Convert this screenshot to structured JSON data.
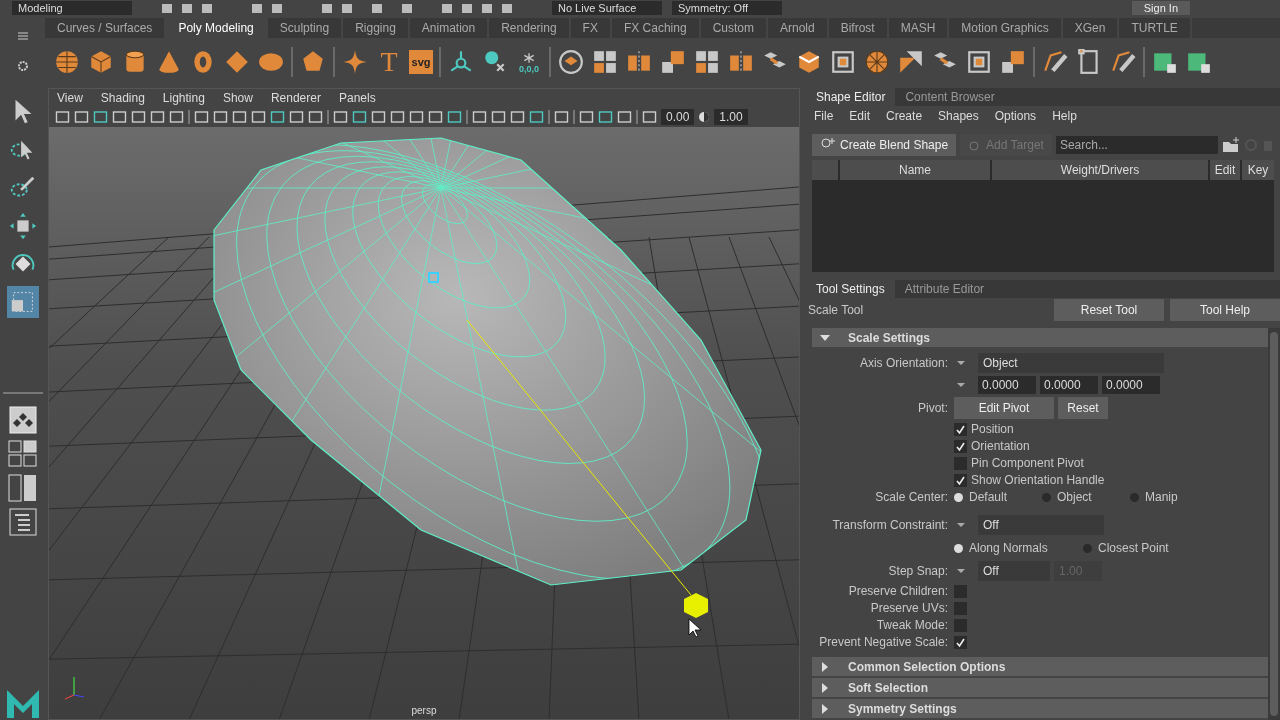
{
  "status_line": {
    "workspace": "Modeling",
    "live_surface": "No Live Surface",
    "symmetry": "Symmetry: Off",
    "sign_in": "Sign In"
  },
  "shelf": {
    "tabs": [
      {
        "label": "Curves / Surfaces",
        "selected": false
      },
      {
        "label": "Poly Modeling",
        "selected": true
      },
      {
        "label": "Sculpting",
        "selected": false
      },
      {
        "label": "Rigging",
        "selected": false
      },
      {
        "label": "Animation",
        "selected": false
      },
      {
        "label": "Rendering",
        "selected": false
      },
      {
        "label": "FX",
        "selected": false
      },
      {
        "label": "FX Caching",
        "selected": false
      },
      {
        "label": "Custom",
        "selected": false
      },
      {
        "label": "Arnold",
        "selected": false
      },
      {
        "label": "Bifrost",
        "selected": false
      },
      {
        "label": "MASH",
        "selected": false
      },
      {
        "label": "Motion Graphics",
        "selected": false
      },
      {
        "label": "XGen",
        "selected": false
      },
      {
        "label": "TURTLE",
        "selected": false
      }
    ],
    "text_tool": "T",
    "svg_tool": "svg",
    "freeze_tool": "0,0,0"
  },
  "toolbox": {
    "tools": [
      {
        "kind": "select",
        "selected": false
      },
      {
        "kind": "lasso",
        "selected": false
      },
      {
        "kind": "paint",
        "selected": false
      },
      {
        "kind": "move",
        "selected": false
      },
      {
        "kind": "rotate",
        "selected": false
      },
      {
        "kind": "scale",
        "selected": true
      }
    ]
  },
  "viewport": {
    "menu": [
      "View",
      "Shading",
      "Lighting",
      "Show",
      "Renderer",
      "Panels"
    ],
    "exposure": "0.00",
    "gamma": "1.00",
    "camera": "persp"
  },
  "shape_editor": {
    "tabs": [
      {
        "label": "Shape Editor",
        "selected": true
      },
      {
        "label": "Content Browser",
        "selected": false
      }
    ],
    "menu": [
      "File",
      "Edit",
      "Create",
      "Shapes",
      "Options",
      "Help"
    ],
    "create_button": "Create Blend Shape",
    "add_target": {
      "label": "Add Target",
      "disabled": true
    },
    "search": {
      "placeholder": "Search..."
    },
    "columns": [
      "Name",
      "Weight/Drivers",
      "Edit",
      "Key"
    ]
  },
  "tool_settings": {
    "tabs": [
      {
        "label": "Tool Settings",
        "selected": true
      },
      {
        "label": "Attribute Editor",
        "selected": false
      }
    ],
    "tool_name": "Scale Tool",
    "buttons": [
      "Reset Tool",
      "Tool Help"
    ],
    "scale_section": {
      "title": "Scale Settings",
      "expanded": true
    },
    "axis_orientation": {
      "label": "Axis Orientation:",
      "value": "Object",
      "values": [
        "0.0000",
        "0.0000",
        "0.0000"
      ]
    },
    "pivot": {
      "label": "Pivot:",
      "buttons": [
        "Edit Pivot",
        "Reset"
      ],
      "options": [
        {
          "label": "Position",
          "checked": true
        },
        {
          "label": "Orientation",
          "checked": true
        },
        {
          "label": "Pin Component Pivot",
          "checked": false
        },
        {
          "label": "Show Orientation Handle",
          "checked": true
        }
      ]
    },
    "scale_center": {
      "label": "Scale Center:",
      "options": [
        {
          "label": "Default",
          "selected": true
        },
        {
          "label": "Object",
          "selected": false
        },
        {
          "label": "Manip",
          "selected": false
        }
      ]
    },
    "transform_constraint": {
      "label": "Transform Constraint:",
      "value": "Off",
      "options": [
        {
          "label": "Along Normals",
          "selected": true
        },
        {
          "label": "Closest Point",
          "selected": false
        }
      ]
    },
    "step_snap": {
      "label": "Step Snap:",
      "value": "Off",
      "amount": "1.00",
      "amount_disabled": true
    },
    "flags": [
      {
        "label": "Preserve Children:",
        "checked": false
      },
      {
        "label": "Preserve UVs:",
        "checked": false
      },
      {
        "label": "Tweak Mode:",
        "checked": false
      },
      {
        "label": "Prevent Negative Scale:",
        "checked": true
      }
    ],
    "sections": [
      {
        "title": "Common Selection Options",
        "expanded": false
      },
      {
        "title": "Soft Selection",
        "expanded": false
      },
      {
        "title": "Symmetry Settings",
        "expanded": false
      }
    ]
  }
}
